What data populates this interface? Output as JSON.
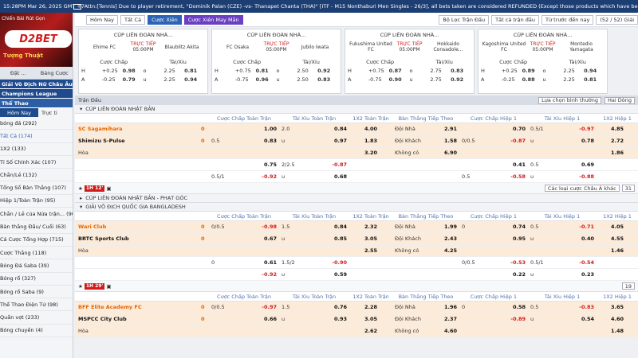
{
  "topbar": {
    "time": "15:28PM Mar 26, 2025 GMT +7",
    "ticker": "Attn:[Tennis] Due to player retirement, \"Dominik Palan (CZE) -vs- Thanapet Chanta (THA)\" [ITF - M15 Nonthaburi Men Singles - 26/3], all bets taken are considered REFUNDED (Except those products which have been determin"
  },
  "sidebar": {
    "bank": "Chiến Bài Rút Gọn",
    "logo": "D2BET",
    "promo": "Tượng Thuật",
    "tabs": [
      "Đặt ...",
      "Bảng Cược"
    ],
    "head1": "Giải Vô Địch Nữ Châu Âu",
    "head2": "Champions League",
    "head3": "Thể Thao",
    "sub": [
      "Hôm Nay",
      "Trực ti"
    ],
    "items": [
      "bóng đá (292)",
      "Tất Cả (174)",
      "1X2 (133)",
      "Tỉ Số Chính Xác (107)",
      "Chẵn/Lẻ (132)",
      "Tổng Số Bàn Thắng (107)",
      "Hiệp 1/Toàn Trận (95)",
      "Chẵn / Lẻ của Nửa trận... (90)",
      "Bàn thắng Đầu/ Cuối (63)",
      "Cá Cược Tổng Hợp (715)",
      "Cược Thắng (118)",
      "Bóng Đá Saba (39)",
      "Bóng rổ (327)",
      "Bóng rổ Saba (9)",
      "Thể Thao Điện Tử (98)",
      "Quần vợt (233)",
      "Bóng chuyền (4)"
    ]
  },
  "controls": {
    "left_partial": "Trận",
    "today": "Hôm Nay",
    "all": "Tất Cả",
    "bet_live": "Cược Xiên",
    "bet_lucky": "Cược Xiên May Mắn",
    "filter": "Bộ Lọc Trận Đấu",
    "all_matches": "Tất cả trận đấu",
    "priority": "Từ trước đến nay",
    "counter": "(52 / 52) Giải"
  },
  "cards": [
    {
      "title": "CÚP LIÊN ĐOÀN NHÀ...",
      "home": "Ehime FC",
      "away": "Blaublitz Akita",
      "live": "TRỰC TIẾP",
      "time": "05:00PM",
      "r1": [
        "H",
        "+0.25",
        "0.98",
        "o",
        "2.25",
        "0.81"
      ],
      "r2": [
        "A",
        "-0.25",
        "0.79",
        "u",
        "2.25",
        "0.94"
      ]
    },
    {
      "title": "CÚP LIÊN ĐOÀN NHÀ...",
      "home": "FC Osaka",
      "away": "Jubilo Iwata",
      "live": "TRỰC TIẾP",
      "time": "05:00PM",
      "r1": [
        "H",
        "+0.75",
        "0.81",
        "o",
        "2.50",
        "0.92"
      ],
      "r2": [
        "A",
        "-0.75",
        "0.96",
        "u",
        "2.50",
        "0.83"
      ]
    },
    {
      "title": "CÚP LIÊN ĐOÀN NHÀ...",
      "home": "Fukushima United FC",
      "away": "Hokkaido Consadole...",
      "live": "TRỰC TIẾP",
      "time": "05:00PM",
      "r1": [
        "H",
        "+0.75",
        "0.87",
        "o",
        "2.75",
        "0.83"
      ],
      "r2": [
        "A",
        "-0.75",
        "0.90",
        "u",
        "2.75",
        "0.92"
      ]
    },
    {
      "title": "CÚP LIÊN ĐOÀN NHÀ...",
      "home": "Kagoshima United FC",
      "away": "Montedio Yamagata",
      "live": "TRỰC TIẾP",
      "time": "05:00PM",
      "r1": [
        "H",
        "+0.25",
        "0.89",
        "o",
        "2.25",
        "0.94"
      ],
      "r2": [
        "A",
        "-0.25",
        "0.88",
        "u",
        "2.25",
        "0.81"
      ]
    }
  ],
  "card_labels": {
    "hcp": "Cược Chấp",
    "ou": "Tài/Xỉu"
  },
  "section": {
    "title": "Trận Đấu",
    "sort": "Lựa chọn bình thường",
    "odds": "Hai Dòng"
  },
  "columns": [
    "Cược Chấp Toàn Trận",
    "Tài Xỉu Toàn Trận",
    "1X2 Toàn Trận",
    "Bàn Thắng Tiếp Theo",
    "Cược Chấp Hiệp 1",
    "Tài Xỉu Hiệp 1",
    "1X2 Hiệp 1"
  ],
  "league1": "CÚP LIÊN ĐOÀN NHẬT BẢN",
  "match1": {
    "home": "SC Sagamihara",
    "away": "Shimizu S-Pulse",
    "draw": "Hòa",
    "hs": "0",
    "as": "0",
    "rows": [
      [
        "",
        "1.00",
        "2.0",
        "0.84",
        "4.00",
        "Đội Nhà",
        "2.91",
        "",
        "0.70",
        "0.5/1",
        "-0.97",
        "4.85"
      ],
      [
        "0.5",
        "0.83",
        "u",
        "0.97",
        "1.83",
        "Đội Khách",
        "1.58",
        "0/0.5",
        "-0.87",
        "u",
        "0.78",
        "2.72"
      ],
      [
        "",
        "",
        "",
        "",
        "3.20",
        "Không có",
        "6.90",
        "",
        "",
        "",
        "",
        "1.86"
      ],
      [
        "",
        "0.75",
        "2/2.5",
        "-0.87",
        "",
        "",
        "",
        "",
        "0.41",
        "0.5",
        "0.69",
        ""
      ],
      [
        "0.5/1",
        "-0.92",
        "u",
        "0.68",
        "",
        "",
        "",
        "0.5",
        "-0.58",
        "u",
        "-0.88",
        ""
      ]
    ]
  },
  "timebar1": {
    "tag": "1H 12'",
    "right1": "Các loại cược Châu Á khác",
    "right2": "31"
  },
  "league2": "CÚP LIÊN ĐOÀN NHẬT BẢN - PHẠT GÓC",
  "league3": "GIẢI VÔ ĐỊCH QUỐC GIA BANGLADESH",
  "match2": {
    "home": "Wari Club",
    "away": "BRTC Sports Club",
    "draw": "Hòa",
    "hs": "0",
    "as": "0",
    "rows": [
      [
        "0/0.5",
        "-0.98",
        "1.5",
        "0.84",
        "2.32",
        "Đội Nhà",
        "1.99",
        "0",
        "0.74",
        "0.5",
        "-0.71",
        "4.05"
      ],
      [
        "",
        "0.67",
        "u",
        "0.85",
        "3.05",
        "Đội Khách",
        "2.43",
        "",
        "0.95",
        "u",
        "0.40",
        "4.55"
      ],
      [
        "",
        "",
        "",
        "",
        "2.55",
        "Không có",
        "4.25",
        "",
        "",
        "",
        "",
        "1.46"
      ],
      [
        "0",
        "0.61",
        "1.5/2",
        "-0.90",
        "",
        "",
        "",
        "0/0.5",
        "-0.53",
        "0.5/1",
        "-0.54",
        ""
      ],
      [
        "",
        "-0.92",
        "u",
        "0.59",
        "",
        "",
        "",
        "",
        "0.22",
        "u",
        "0.23",
        ""
      ]
    ]
  },
  "timebar2": {
    "tag": "1H 29'",
    "right": "19"
  },
  "match3": {
    "home": "BFF Elite Academy FC",
    "away": "MSPCC City Club",
    "draw": "Hòa",
    "hs": "0",
    "as": "0",
    "rows": [
      [
        "0/0.5",
        "-0.97",
        "1.5",
        "0.76",
        "2.28",
        "Đội Nhà",
        "1.96",
        "0",
        "0.58",
        "0.5",
        "-0.83",
        "3.65"
      ],
      [
        "",
        "0.66",
        "u",
        "0.93",
        "3.05",
        "Đội Khách",
        "2.37",
        "",
        "-0.89",
        "u",
        "0.54",
        "4.60"
      ],
      [
        "",
        "",
        "",
        "",
        "2.62",
        "Không có",
        "4.60",
        "",
        "",
        "",
        "",
        "1.48"
      ]
    ]
  }
}
